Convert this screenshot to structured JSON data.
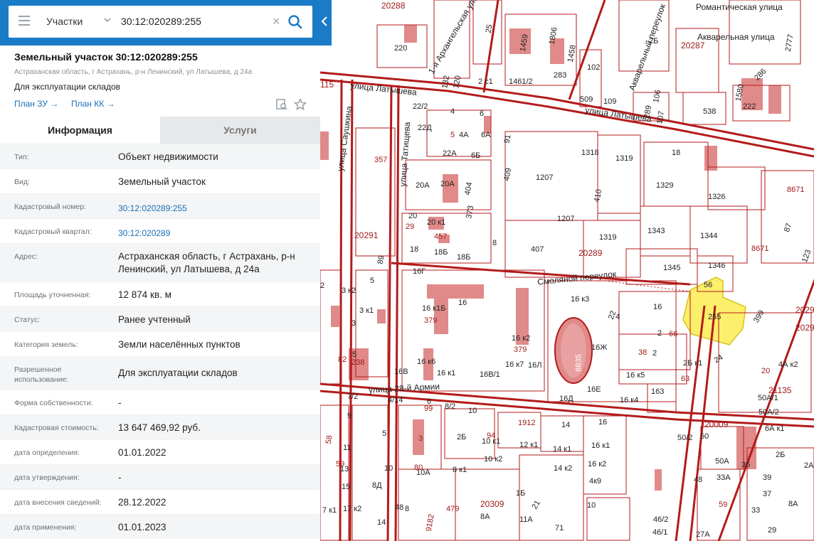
{
  "search": {
    "type_label": "Участки",
    "query": "30:12:020289:255"
  },
  "parcel": {
    "title": "Земельный участок 30:12:020289:255",
    "address": "Астраханская область, г Астрахань, р-н Ленинский, ул Латышева, д 24а",
    "usage": "Для эксплуатации складов",
    "plan_zu": "План ЗУ →",
    "plan_kk": "План КК →"
  },
  "tabs": {
    "info": "Информация",
    "services": "Услуги"
  },
  "rows": [
    {
      "label": "Тип:",
      "value": "Объект недвижимости"
    },
    {
      "label": "Вид:",
      "value": "Земельный участок"
    },
    {
      "label": "Кадастровый номер:",
      "value": "30:12:020289:255"
    },
    {
      "label": "Кадастровый квартал:",
      "value": "30:12:020289"
    },
    {
      "label": "Адрес:",
      "value": "Астраханская область, г Астрахань, р-н Ленинский, ул Латышева, д 24а"
    },
    {
      "label": "Площадь уточненная:",
      "value": "12 874 кв. м"
    },
    {
      "label": "Статус:",
      "value": "Ранее учтенный"
    },
    {
      "label": "Категория земель:",
      "value": "Земли населённых пунктов"
    },
    {
      "label": "Разрешенное использование:",
      "value": "Для эксплуатации складов"
    },
    {
      "label": "Форма собственности:",
      "value": "-"
    },
    {
      "label": "Кадастровая стоимость:",
      "value": "13 647 469,92 руб."
    },
    {
      "label": "дата определения:",
      "value": "01.01.2022"
    },
    {
      "label": "дата утверждения:",
      "value": "-"
    },
    {
      "label": "дата внесения сведений:",
      "value": "28.12.2022"
    },
    {
      "label": "дата применения:",
      "value": "01.01.2023"
    }
  ],
  "map": {
    "streets": {
      "latysheva_w": "улица Латышева",
      "latysheva_e": "улица Латышева",
      "saushkina": "улица Саушкина",
      "tatishcheva": "улица Татищева",
      "smolyanoy": "Смоляной переулок",
      "army28": "улица 28-й Армии",
      "romanticheskaya": "Романтическая улица",
      "akvarelnaya": "Акварельная улица",
      "akvarelny_per": "Акварельный переулок",
      "arkhangelskaya": "1-я Архангельская улица"
    },
    "blocks": {
      "b20288": "20288",
      "b20287": "20287",
      "b20291": "20291",
      "b20289": "20289",
      "b20309": "20309",
      "b20009": "20009",
      "b21135": "21135",
      "b2029a": "2029",
      "b2029b": "2029"
    },
    "labels": {
      "l220": "220",
      "l1461": "1461/2",
      "l283": "283",
      "l509": "509",
      "l109": "109",
      "l102": "102",
      "l2c1": "2 с1",
      "l289": "289",
      "l538": "538",
      "l222": "222",
      "l1580": "1580",
      "l286": "286",
      "l2B": "2Б",
      "l115": "115",
      "l22_2": "22/2",
      "l22D": "22Д",
      "l4": "4",
      "l6": "6",
      "l5": "5",
      "l4A": "4А",
      "l6A": "6А",
      "l91": "91",
      "l22A": "22А",
      "l6B": "6Б",
      "l357": "357",
      "l1318": "1318",
      "l1319": "1319",
      "l18": "18",
      "l409": "409",
      "l1207": "1207",
      "l20A_a": "20А",
      "l20A_b": "20А",
      "l404": "404",
      "l373": "373",
      "l410": "410",
      "l1329": "1329",
      "l1326": "1326",
      "l8671a": "8671",
      "l20": "20",
      "l29": "29",
      "l20k1": "20 к1",
      "l457": "457",
      "l1207b": "1207",
      "l1343": "1343",
      "l1344": "1344",
      "l87": "87",
      "l1319b": "1319",
      "l18b": "18",
      "l18B5": "18Б",
      "l18B": "18Б",
      "l8": "8",
      "l407": "407",
      "l8671b": "8671",
      "l89": "89",
      "l1345": "1345",
      "l1346": "1346",
      "l123": "123",
      "l16G": "16Г",
      "l56": "56",
      "l255": "255",
      "l5b": "5",
      "l3k2": "3 к2",
      "l16k1B": "16 к1Б",
      "l16": "16",
      "l16k3": "16 к3",
      "l16b": "16",
      "l379": "379",
      "l2": "2",
      "l3k1": "3 к1",
      "l3": "3",
      "l22": "22",
      "l4b": "4",
      "l399": "399",
      "l16k2": "16 к2",
      "l2b": "2",
      "l66": "66",
      "l379b": "379",
      "l8835": "8835",
      "l16ZH": "16Ж",
      "l38": "38",
      "l2c": "2",
      "l5c": "5",
      "l82": "82",
      "l238": "238",
      "l16k7": "16 к7",
      "l16L": "16Л",
      "l16k6": "16 к6",
      "l2Bk1": "2Б к1",
      "l24": "24",
      "l4Ak2": "4А к2",
      "l16V": "16В",
      "l16k1": "16 к1",
      "l16V1": "16В/1",
      "l16k5": "16 к5",
      "l63": "63",
      "l20q": "20",
      "l16E": "16Е",
      "l163": "163",
      "l7_2": "7/2",
      "l16D": "16Д",
      "l16k4": "16 к4",
      "l4_14": "4/14",
      "l6c": "6",
      "l99": "99",
      "l8_2": "8/2",
      "l10": "10",
      "l50A1": "50А/1",
      "l9": "9",
      "l1912": "1912",
      "l14": "14",
      "l16c": "16",
      "l50A2": "50А/2",
      "l5d": "5",
      "l3b": "3",
      "l2Bb": "2Б",
      "l94": "94",
      "l10k1": "10 к1",
      "l12k1": "12 к1",
      "l14k1": "14 к1",
      "l16k1b": "16 к1",
      "l6Ak1": "6А к1",
      "l58": "58",
      "l11": "11",
      "l10k2": "10 к2",
      "l50_2": "50/2",
      "l50": "50",
      "l2Bc": "2Б",
      "l59": "59",
      "l13": "13",
      "l10b": "10",
      "l80": "80",
      "l10A": "10А",
      "l8k1": "8 к1",
      "l14k2": "14 к2",
      "l16k2b": "16 к2",
      "l50Ab": "50А",
      "l35": "35",
      "l15": "15",
      "l8D": "8Д",
      "l1B": "1Б",
      "l4k9": "4к9",
      "l48": "48",
      "l33A": "33А",
      "l39": "39",
      "l37": "37",
      "l7k1": "7 к1",
      "l17k2": "17 к2",
      "l48b": "48",
      "l8b": "8",
      "l479": "479",
      "l21": "21",
      "l10q": "10",
      "l8A": "8А",
      "l14b": "14",
      "l9182": "9182",
      "l8Ab": "8А",
      "l71": "71",
      "l11A": "11А",
      "l46_2": "46/2",
      "l46_1": "46/1",
      "l27A": "27А",
      "l29b": "29",
      "l33": "33",
      "l5e": "5",
      "l3c": "3",
      "l6B_b": "6Б",
      "l2A": "2А",
      "l1459": "1459",
      "l1806": "1806",
      "l1458": "1458",
      "l25": "25",
      "l132": "132",
      "l120": "120",
      "l3d": "3",
      "l2777": "2777",
      "l106": "106",
      "l107": "107",
      "l4Ab": "4А к2"
    }
  }
}
